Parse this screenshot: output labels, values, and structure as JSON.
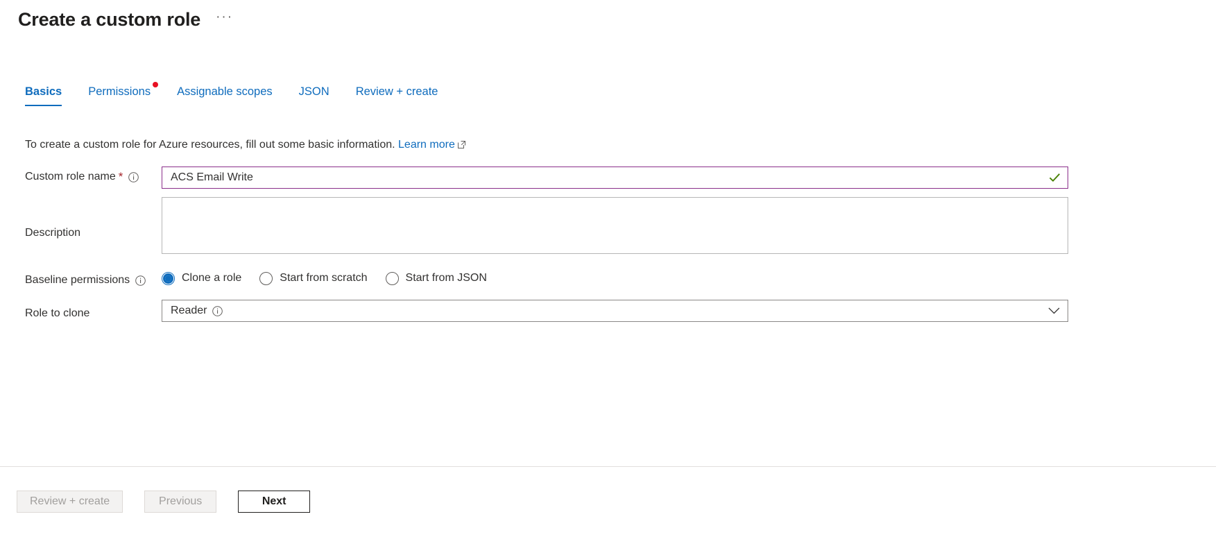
{
  "header": {
    "title": "Create a custom role",
    "more_menu_label": "···"
  },
  "tabs": [
    {
      "label": "Basics",
      "active": true,
      "has_dot": false
    },
    {
      "label": "Permissions",
      "active": false,
      "has_dot": true
    },
    {
      "label": "Assignable scopes",
      "active": false,
      "has_dot": false
    },
    {
      "label": "JSON",
      "active": false,
      "has_dot": false
    },
    {
      "label": "Review + create",
      "active": false,
      "has_dot": false
    }
  ],
  "intro": {
    "text": "To create a custom role for Azure resources, fill out some basic information.",
    "link_label": "Learn more"
  },
  "form": {
    "custom_role_name": {
      "label": "Custom role name",
      "required_mark": "*",
      "value": "ACS Email Write",
      "placeholder": "",
      "validation_state": "valid"
    },
    "description": {
      "label": "Description",
      "value": "",
      "placeholder": ""
    },
    "baseline_permissions": {
      "label": "Baseline permissions",
      "selected": "Clone a role",
      "options": [
        {
          "label": "Clone a role",
          "selected": true
        },
        {
          "label": "Start from scratch",
          "selected": false
        },
        {
          "label": "Start from JSON",
          "selected": false
        }
      ]
    },
    "role_to_clone": {
      "label": "Role to clone",
      "value": "Reader",
      "options": [
        "Reader"
      ]
    }
  },
  "footer": {
    "review_create_label": "Review + create",
    "previous_label": "Previous",
    "next_label": "Next"
  },
  "colors": {
    "accent_blue": "#0f6cbd",
    "required_red": "#a4262c",
    "dot_red": "#e81123",
    "valid_border": "#8a2d8a",
    "valid_check": "#498205",
    "text": "#323130"
  }
}
